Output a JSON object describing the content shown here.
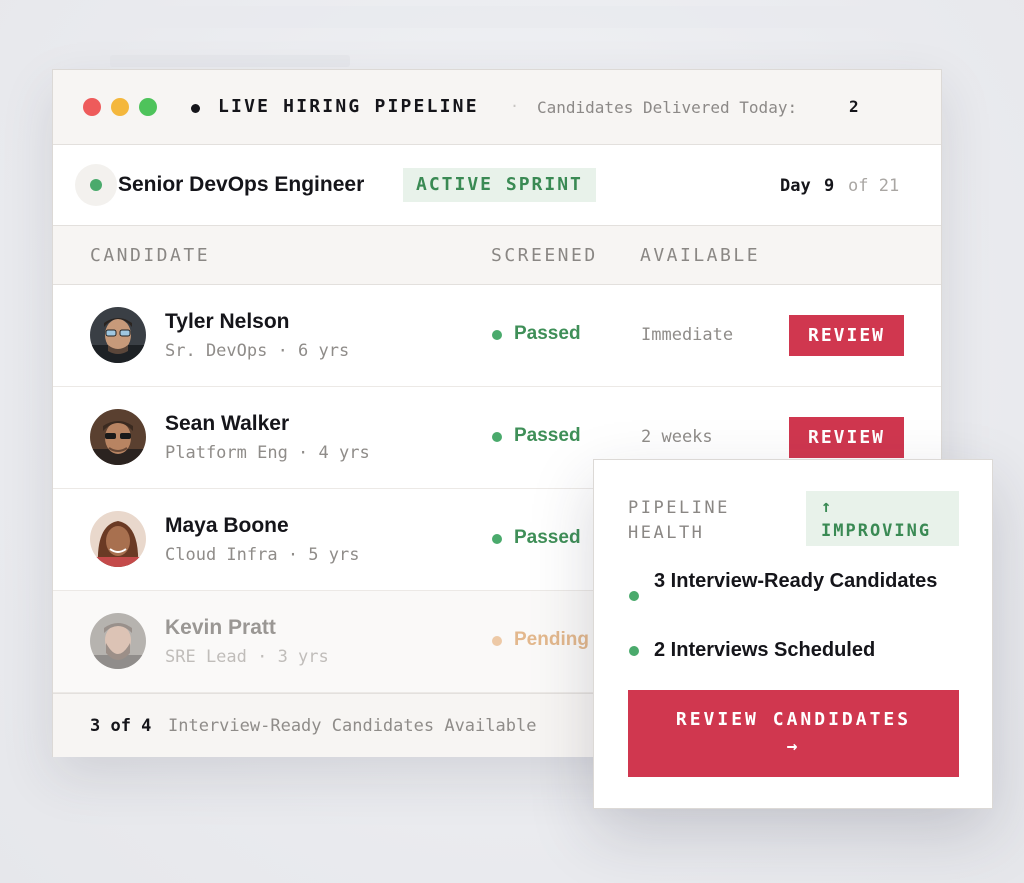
{
  "window": {
    "title": "LIVE HIRING PIPELINE",
    "separator": "·",
    "delivered_label": "Candidates Delivered Today:",
    "delivered_count": "2"
  },
  "job": {
    "title": "Senior DevOps Engineer",
    "status_badge": "ACTIVE SPRINT",
    "day_label": "Day",
    "day_current": "9",
    "day_of": "of 21"
  },
  "table": {
    "columns": [
      "CANDIDATE",
      "SCREENED",
      "AVAILABLE"
    ],
    "rows": [
      {
        "name": "Tyler Nelson",
        "role": "Sr. DevOps · 6 yrs",
        "screened": "Passed",
        "available": "Immediate",
        "action": "REVIEW"
      },
      {
        "name": "Sean Walker",
        "role": "Platform Eng · 4 yrs",
        "screened": "Passed",
        "available": "2 weeks",
        "action": "REVIEW"
      },
      {
        "name": "Maya Boone",
        "role": "Cloud Infra · 5 yrs",
        "screened": "Passed",
        "available": "",
        "action": ""
      },
      {
        "name": "Kevin Pratt",
        "role": "SRE Lead · 3 yrs",
        "screened": "Pending",
        "available": "",
        "action": ""
      }
    ]
  },
  "footer": {
    "count": "3 of 4",
    "text": "Interview-Ready Candidates Available"
  },
  "health": {
    "label": "PIPELINE HEALTH",
    "badge_arrow": "↑",
    "badge_text": "IMPROVING",
    "items": [
      "3 Interview-Ready Candidates",
      "2 Interviews Scheduled"
    ],
    "cta_label": "REVIEW CANDIDATES",
    "cta_arrow": "→"
  },
  "colors": {
    "accent": "#d0374f",
    "success": "#4aaa6c",
    "pending": "#edc9a6",
    "badge_bg": "#e8f2ea"
  }
}
